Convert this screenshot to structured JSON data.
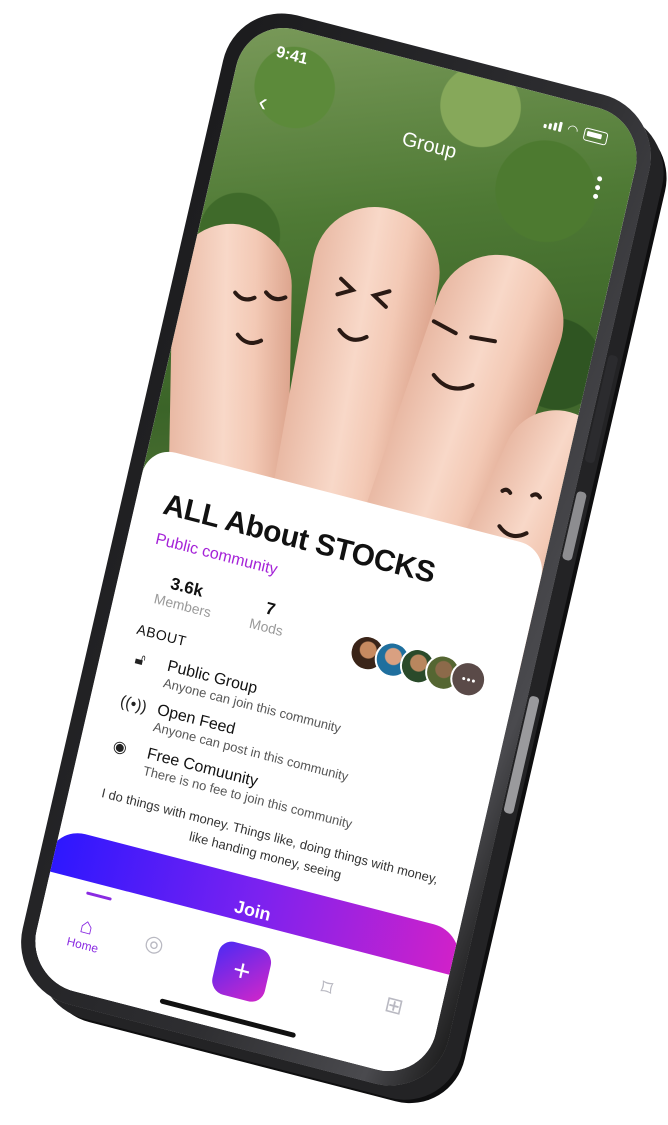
{
  "status_bar": {
    "time": "9:41"
  },
  "header": {
    "title": "Group"
  },
  "group": {
    "name": "ALL About STOCKS",
    "type": "Public community",
    "members_value": "3.6k",
    "members_label": "Members",
    "mods_value": "7",
    "mods_label": "Mods"
  },
  "about": {
    "label": "ABOUT",
    "features": [
      {
        "icon": "unlock-icon",
        "title": "Public Group",
        "subtitle": "Anyone can join this community"
      },
      {
        "icon": "broadcast-icon",
        "title": "Open Feed",
        "subtitle": "Anyone can post in this community"
      },
      {
        "icon": "eye-icon",
        "title": "Free Comuunity",
        "subtitle": "There is no fee to join this community"
      }
    ],
    "description": "I do things with money. Things like, doing things with money, like handing money, seeing"
  },
  "join_button": {
    "label": "Join"
  },
  "tabbar": {
    "home_label": "Home",
    "items": [
      "home-icon",
      "compass-icon",
      "plus-icon",
      "bookmark-icon",
      "grid-icon"
    ]
  },
  "colors": {
    "accent": "#8a2be2",
    "gradient_start": "#2b17ff",
    "gradient_end": "#d221c8"
  }
}
